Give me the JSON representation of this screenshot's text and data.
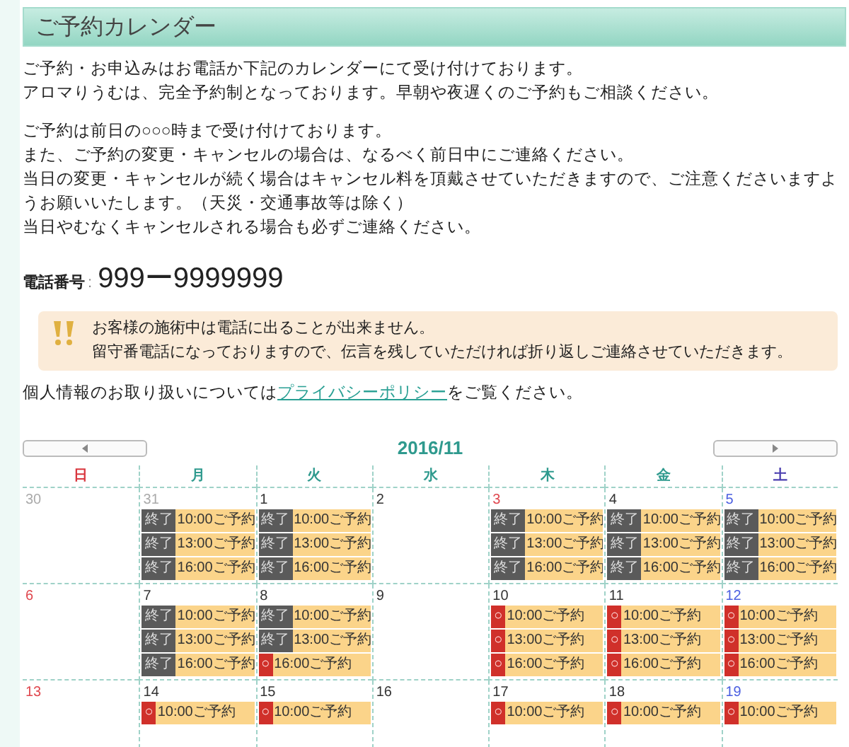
{
  "title": "ご予約カレンダー",
  "intro": [
    "ご予約・お申込みはお電話か下記のカレンダーにて受け付けております。",
    "アロマりうむは、完全予約制となっております。早朝や夜遅くのご予約もご相談ください。"
  ],
  "policy": [
    "ご予約は前日の○○○時まで受け付けております。",
    "また、ご予約の変更・キャンセルの場合は、なるべく前日中にご連絡ください。",
    "当日の変更・キャンセルが続く場合はキャンセル料を頂戴させていただきますので、ご注意くださいますようお願いいたします。（天災・交通事故等は除く）",
    "当日やむなくキャンセルされる場合も必ずご連絡ください。"
  ],
  "phone": {
    "label": "電話番号",
    "separator": ":",
    "number": "999ー9999999"
  },
  "notice": [
    "お客様の施術中は電話に出ることが出来ません。",
    "留守番電話になっておりますので、伝言を残していただければ折り返しご連絡させていただきます。"
  ],
  "privacy": {
    "before": "個人情報のお取り扱いについては",
    "link": "プライバシーポリシー",
    "after": "をご覧ください。"
  },
  "calendar": {
    "month": "2016/11",
    "weekdays": [
      {
        "label": "日",
        "kind": "sunday"
      },
      {
        "label": "月",
        "kind": "weekday"
      },
      {
        "label": "火",
        "kind": "weekday"
      },
      {
        "label": "水",
        "kind": "weekday"
      },
      {
        "label": "木",
        "kind": "weekday"
      },
      {
        "label": "金",
        "kind": "weekday"
      },
      {
        "label": "土",
        "kind": "saturday"
      }
    ],
    "weeks": [
      [
        {
          "day": "30",
          "kind": "other_month"
        },
        {
          "day": "31",
          "kind": "other_month",
          "slots": [
            {
              "kind": "closed",
              "mark": "終了",
              "label": "10:00ご予約"
            },
            {
              "kind": "closed",
              "mark": "終了",
              "label": "13:00ご予約"
            },
            {
              "kind": "closed",
              "mark": "終了",
              "label": "16:00ご予約"
            }
          ]
        },
        {
          "day": "1",
          "kind": "weekday",
          "slots": [
            {
              "kind": "closed",
              "mark": "終了",
              "label": "10:00ご予約"
            },
            {
              "kind": "closed",
              "mark": "終了",
              "label": "13:00ご予約"
            },
            {
              "kind": "closed",
              "mark": "終了",
              "label": "16:00ご予約"
            }
          ]
        },
        {
          "day": "2",
          "kind": "weekday"
        },
        {
          "day": "3",
          "kind": "holiday",
          "slots": [
            {
              "kind": "closed",
              "mark": "終了",
              "label": "10:00ご予約"
            },
            {
              "kind": "closed",
              "mark": "終了",
              "label": "13:00ご予約"
            },
            {
              "kind": "closed",
              "mark": "終了",
              "label": "16:00ご予約"
            }
          ]
        },
        {
          "day": "4",
          "kind": "weekday",
          "slots": [
            {
              "kind": "closed",
              "mark": "終了",
              "label": "10:00ご予約"
            },
            {
              "kind": "closed",
              "mark": "終了",
              "label": "13:00ご予約"
            },
            {
              "kind": "closed",
              "mark": "終了",
              "label": "16:00ご予約"
            }
          ]
        },
        {
          "day": "5",
          "kind": "saturday",
          "slots": [
            {
              "kind": "closed",
              "mark": "終了",
              "label": "10:00ご予約"
            },
            {
              "kind": "closed",
              "mark": "終了",
              "label": "13:00ご予約"
            },
            {
              "kind": "closed",
              "mark": "終了",
              "label": "16:00ご予約"
            }
          ]
        }
      ],
      [
        {
          "day": "6",
          "kind": "sunday"
        },
        {
          "day": "7",
          "kind": "weekday",
          "slots": [
            {
              "kind": "closed",
              "mark": "終了",
              "label": "10:00ご予約"
            },
            {
              "kind": "closed",
              "mark": "終了",
              "label": "13:00ご予約"
            },
            {
              "kind": "closed",
              "mark": "終了",
              "label": "16:00ご予約"
            }
          ]
        },
        {
          "day": "8",
          "kind": "weekday",
          "slots": [
            {
              "kind": "closed",
              "mark": "終了",
              "label": "10:00ご予約"
            },
            {
              "kind": "closed",
              "mark": "終了",
              "label": "13:00ご予約"
            },
            {
              "kind": "open",
              "mark": "○",
              "label": "16:00ご予約"
            }
          ]
        },
        {
          "day": "9",
          "kind": "weekday"
        },
        {
          "day": "10",
          "kind": "weekday",
          "slots": [
            {
              "kind": "open",
              "mark": "○",
              "label": "10:00ご予約"
            },
            {
              "kind": "open",
              "mark": "○",
              "label": "13:00ご予約"
            },
            {
              "kind": "open",
              "mark": "○",
              "label": "16:00ご予約"
            }
          ]
        },
        {
          "day": "11",
          "kind": "weekday",
          "slots": [
            {
              "kind": "open",
              "mark": "○",
              "label": "10:00ご予約"
            },
            {
              "kind": "open",
              "mark": "○",
              "label": "13:00ご予約"
            },
            {
              "kind": "open",
              "mark": "○",
              "label": "16:00ご予約"
            }
          ]
        },
        {
          "day": "12",
          "kind": "saturday",
          "slots": [
            {
              "kind": "open",
              "mark": "○",
              "label": "10:00ご予約"
            },
            {
              "kind": "open",
              "mark": "○",
              "label": "13:00ご予約"
            },
            {
              "kind": "open",
              "mark": "○",
              "label": "16:00ご予約"
            }
          ]
        }
      ],
      [
        {
          "day": "13",
          "kind": "sunday"
        },
        {
          "day": "14",
          "kind": "weekday",
          "slots": [
            {
              "kind": "open",
              "mark": "○",
              "label": "10:00ご予約"
            }
          ]
        },
        {
          "day": "15",
          "kind": "weekday",
          "slots": [
            {
              "kind": "open",
              "mark": "○",
              "label": "10:00ご予約"
            }
          ]
        },
        {
          "day": "16",
          "kind": "weekday"
        },
        {
          "day": "17",
          "kind": "weekday",
          "slots": [
            {
              "kind": "open",
              "mark": "○",
              "label": "10:00ご予約"
            }
          ]
        },
        {
          "day": "18",
          "kind": "weekday",
          "slots": [
            {
              "kind": "open",
              "mark": "○",
              "label": "10:00ご予約"
            }
          ]
        },
        {
          "day": "19",
          "kind": "saturday",
          "slots": [
            {
              "kind": "open",
              "mark": "○",
              "label": "10:00ご予約"
            }
          ]
        }
      ]
    ]
  }
}
